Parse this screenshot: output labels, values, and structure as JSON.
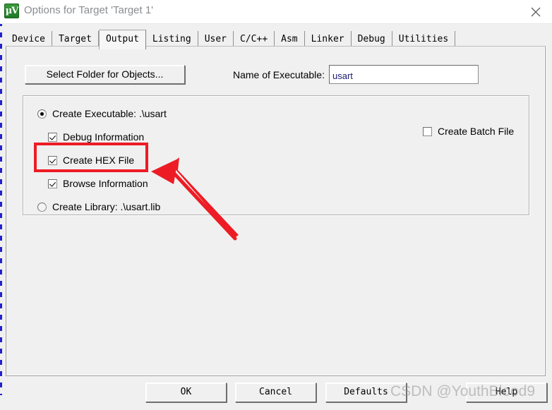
{
  "window": {
    "title": "Options for Target 'Target 1'",
    "icon": "uvision-logo-icon",
    "close_icon": "close-icon"
  },
  "tabs": [
    {
      "label": "Device",
      "active": false
    },
    {
      "label": "Target",
      "active": false
    },
    {
      "label": "Output",
      "active": true
    },
    {
      "label": "Listing",
      "active": false
    },
    {
      "label": "User",
      "active": false
    },
    {
      "label": "C/C++",
      "active": false
    },
    {
      "label": "Asm",
      "active": false
    },
    {
      "label": "Linker",
      "active": false
    },
    {
      "label": "Debug",
      "active": false
    },
    {
      "label": "Utilities",
      "active": false
    }
  ],
  "output_tab": {
    "select_folder_button": "Select Folder for Objects...",
    "executable_label": "Name of Executable:",
    "executable_value": "usart",
    "create_executable": {
      "label": "Create Executable:  .\\usart",
      "selected": true
    },
    "debug_information": {
      "label": "Debug Information",
      "checked": true
    },
    "create_hex_file": {
      "label": "Create HEX File",
      "checked": true
    },
    "browse_information": {
      "label": "Browse Information",
      "checked": true
    },
    "create_library": {
      "label": "Create Library:  .\\usart.lib",
      "selected": false
    },
    "create_batch_file": {
      "label": "Create Batch File",
      "checked": false
    }
  },
  "footer": {
    "ok": "OK",
    "cancel": "Cancel",
    "defaults": "Defaults",
    "help": "Help"
  },
  "annotation": {
    "highlight_target": "create_hex_file",
    "color": "#ed1c24"
  },
  "watermark": "CSDN @YouthBlood9"
}
